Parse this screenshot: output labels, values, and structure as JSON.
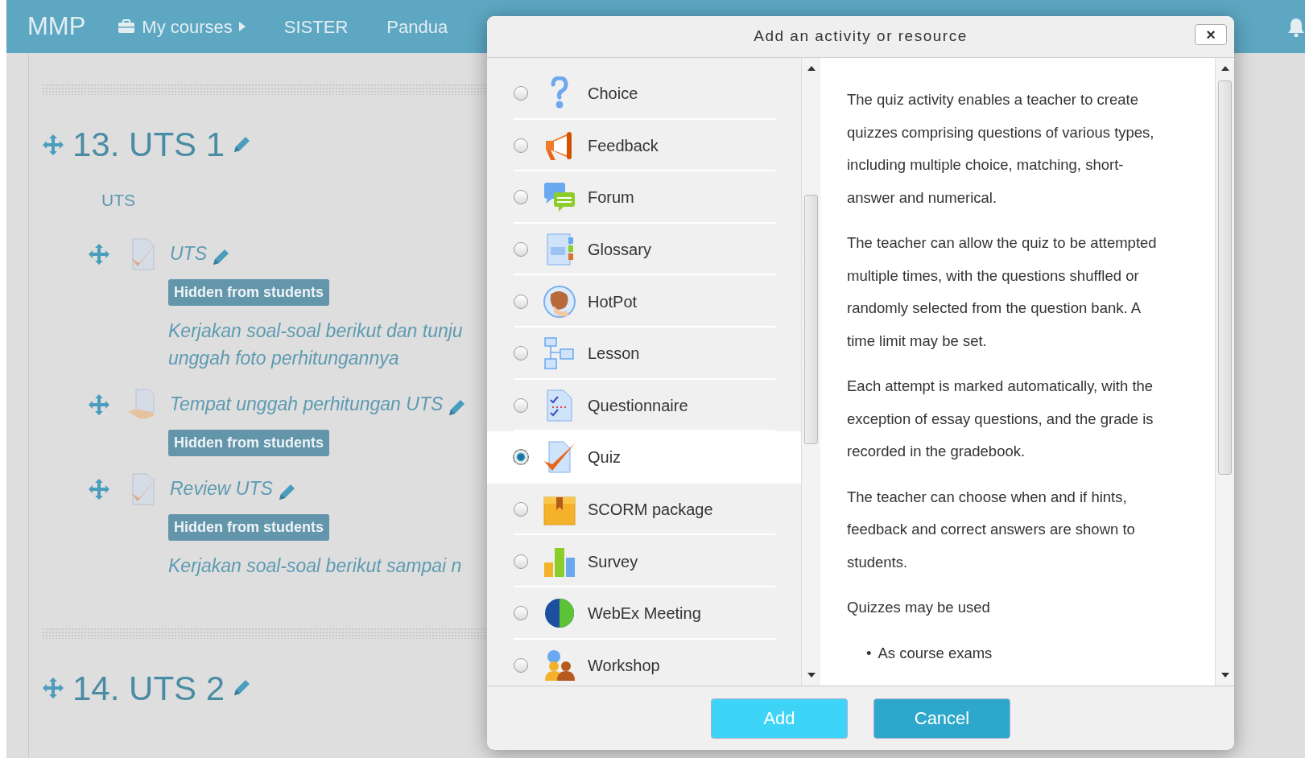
{
  "navbar": {
    "brand": "MMP",
    "items": [
      {
        "label": "My courses",
        "kind": "dropdown"
      },
      {
        "label": "SISTER",
        "kind": "link"
      },
      {
        "label": "Pandua",
        "kind": "link"
      }
    ]
  },
  "sections": [
    {
      "title": "13. UTS 1",
      "summary": "UTS",
      "activities": [
        {
          "name": "UTS",
          "kind": "quiz",
          "badge": "Hidden from students",
          "description": [
            "Kerjakan soal-soal berikut dan tunju",
            "unggah foto perhitungannya"
          ]
        },
        {
          "name": "Tempat unggah perhitungan UTS",
          "kind": "assignment",
          "badge": "Hidden from students"
        },
        {
          "name": "Review UTS",
          "kind": "quiz",
          "badge": "Hidden from students",
          "description": [
            "Kerjakan soal-soal berikut sampai n"
          ]
        }
      ]
    },
    {
      "title": "14. UTS 2"
    }
  ],
  "dialog": {
    "title": "Add an activity or resource",
    "close": "×",
    "options": [
      {
        "label": "Choice",
        "selected": false
      },
      {
        "label": "Feedback",
        "selected": false
      },
      {
        "label": "Forum",
        "selected": false
      },
      {
        "label": "Glossary",
        "selected": false
      },
      {
        "label": "HotPot",
        "selected": false
      },
      {
        "label": "Lesson",
        "selected": false
      },
      {
        "label": "Questionnaire",
        "selected": false
      },
      {
        "label": "Quiz",
        "selected": true
      },
      {
        "label": "SCORM package",
        "selected": false
      },
      {
        "label": "Survey",
        "selected": false
      },
      {
        "label": "WebEx Meeting",
        "selected": false
      },
      {
        "label": "Workshop",
        "selected": false
      }
    ],
    "description": [
      "The quiz activity enables a teacher to create quizzes comprising questions of various types, including multiple choice, matching, short-answer and numerical.",
      "The teacher can allow the quiz to be attempted multiple times, with the questions shuffled or randomly selected from the question bank. A time limit may be set.",
      "Each attempt is marked automatically, with the exception of essay questions, and the grade is recorded in the gradebook.",
      "The teacher can choose when and if hints, feedback and correct answers are shown to students.",
      "Quizzes may be used"
    ],
    "bullets": [
      {
        "marker": "•",
        "text": "As course exams"
      }
    ],
    "buttons": [
      {
        "label": "Add",
        "kind": "primary"
      },
      {
        "label": "Cancel",
        "kind": "secondary"
      }
    ]
  }
}
